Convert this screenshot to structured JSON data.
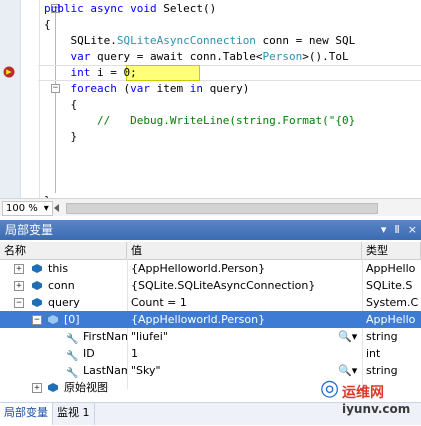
{
  "editor": {
    "lines": [
      [
        {
          "t": "public async void ",
          "c": "kw"
        },
        {
          "t": "Select()",
          "c": ""
        }
      ],
      [
        {
          "t": "{",
          "c": ""
        }
      ],
      [
        {
          "t": "    SQLite.",
          "c": ""
        },
        {
          "t": "SQLiteAsyncConnection",
          "c": "ty"
        },
        {
          "t": " conn = new SQL",
          "c": ""
        }
      ],
      [
        {
          "t": "    var",
          "c": "kw"
        },
        {
          "t": " query = await conn.Table<",
          "c": ""
        },
        {
          "t": "Person",
          "c": "ty"
        },
        {
          "t": ">().ToL",
          "c": ""
        }
      ],
      [
        {
          "t": "    int",
          "c": "kw"
        },
        {
          "t": " i = 0;",
          "c": ""
        }
      ],
      [
        {
          "t": "    foreach",
          "c": "kw"
        },
        {
          "t": " (",
          "c": ""
        },
        {
          "t": "var",
          "c": "kw"
        },
        {
          "t": " item ",
          "c": ""
        },
        {
          "t": "in",
          "c": "kw"
        },
        {
          "t": " query)",
          "c": ""
        }
      ],
      [
        {
          "t": "    {",
          "c": ""
        }
      ],
      [
        {
          "t": "        //   Debug.WriteLine(string.Format(\"{0}",
          "c": "cm"
        }
      ],
      [
        {
          "t": "    }",
          "c": ""
        }
      ],
      [
        {
          "t": "",
          "c": ""
        }
      ],
      [
        {
          "t": "",
          "c": ""
        }
      ],
      [
        {
          "t": "",
          "c": ""
        }
      ],
      [
        {
          "t": "}",
          "c": ""
        }
      ]
    ],
    "zoom": "100 %"
  },
  "locals": {
    "title": "局部变量",
    "title_controls": [
      "▾",
      "Ⅱ",
      "×"
    ],
    "columns": {
      "name": "名称",
      "value": "值",
      "type": "类型"
    },
    "rows": [
      {
        "name": "this",
        "value": "{AppHelloworld.Person}",
        "type": "AppHello"
      },
      {
        "name": "conn",
        "value": "{SQLite.SQLiteAsyncConnection}",
        "type": "SQLite.S"
      },
      {
        "name": "query",
        "value": "Count = 1",
        "type": "System.C"
      },
      {
        "name": "[0]",
        "value": "{AppHelloworld.Person}",
        "type": "AppHello"
      },
      {
        "name": "FirstNam",
        "value": "\"liufei\"",
        "type": "string"
      },
      {
        "name": "ID",
        "value": "1",
        "type": "int"
      },
      {
        "name": "LastNam",
        "value": "\"Sky\"",
        "type": "string"
      },
      {
        "name": "原始视图",
        "value": "",
        "type": ""
      }
    ],
    "tabs": [
      "局部变量",
      "监视 1"
    ]
  },
  "watermark": {
    "cn": "运维网",
    "url": "iyunv.com"
  }
}
